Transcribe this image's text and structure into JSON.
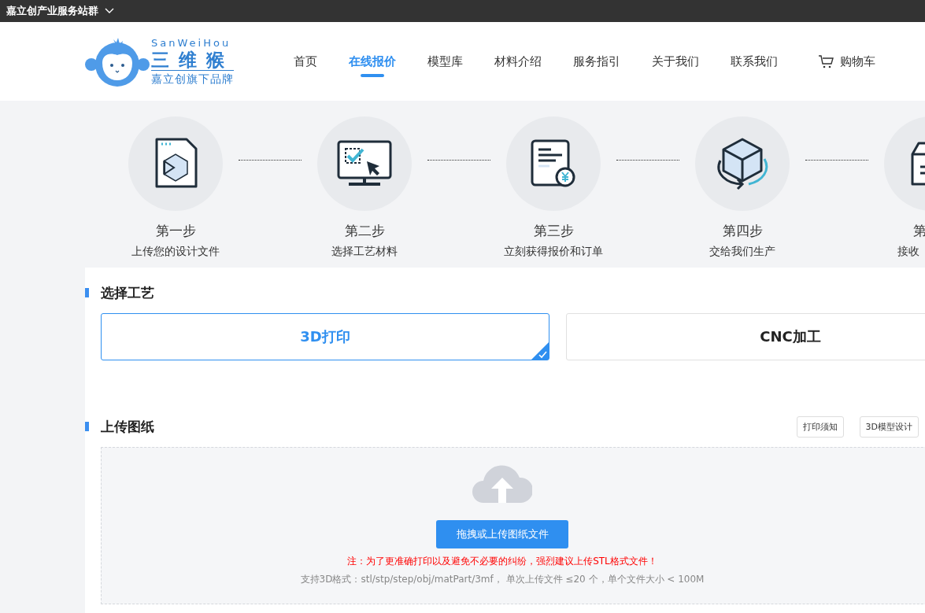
{
  "top_bar": {
    "title": "嘉立创产业服务站群"
  },
  "logo": {
    "latin": "SanWeiHou",
    "name": "三 维 猴",
    "tagline": "嘉立创旗下品牌"
  },
  "nav": [
    {
      "label": "首页",
      "selected": false
    },
    {
      "label": "在线报价",
      "selected": true
    },
    {
      "label": "模型库",
      "selected": false
    },
    {
      "label": "材料介绍",
      "selected": false
    },
    {
      "label": "服务指引",
      "selected": false
    },
    {
      "label": "关于我们",
      "selected": false
    },
    {
      "label": "联系我们",
      "selected": false
    }
  ],
  "cart": {
    "label": "购物车"
  },
  "steps": [
    {
      "step": "第一步",
      "desc": "上传您的设计文件"
    },
    {
      "step": "第二步",
      "desc": "选择工艺材料"
    },
    {
      "step": "第三步",
      "desc": "立刻获得报价和订单"
    },
    {
      "step": "第四步",
      "desc": "交给我们生产"
    },
    {
      "step": "第",
      "desc": "接收"
    }
  ],
  "process": {
    "heading": "选择工艺",
    "options": [
      {
        "label": "3D打印",
        "selected": true
      },
      {
        "label": "CNC加工",
        "selected": false
      }
    ]
  },
  "upload": {
    "heading": "上传图纸",
    "links": [
      "打印须知",
      "3D模型设计"
    ],
    "button": "拖拽或上传图纸文件",
    "note": "注：为了更准确打印以及避免不必要的纠纷，强烈建议上传STL格式文件！",
    "formats": "支持3D格式：stl/stp/step/obj/matPart/3mf， 单次上传文件 ≤20 个，单个文件大小 < 100M"
  }
}
